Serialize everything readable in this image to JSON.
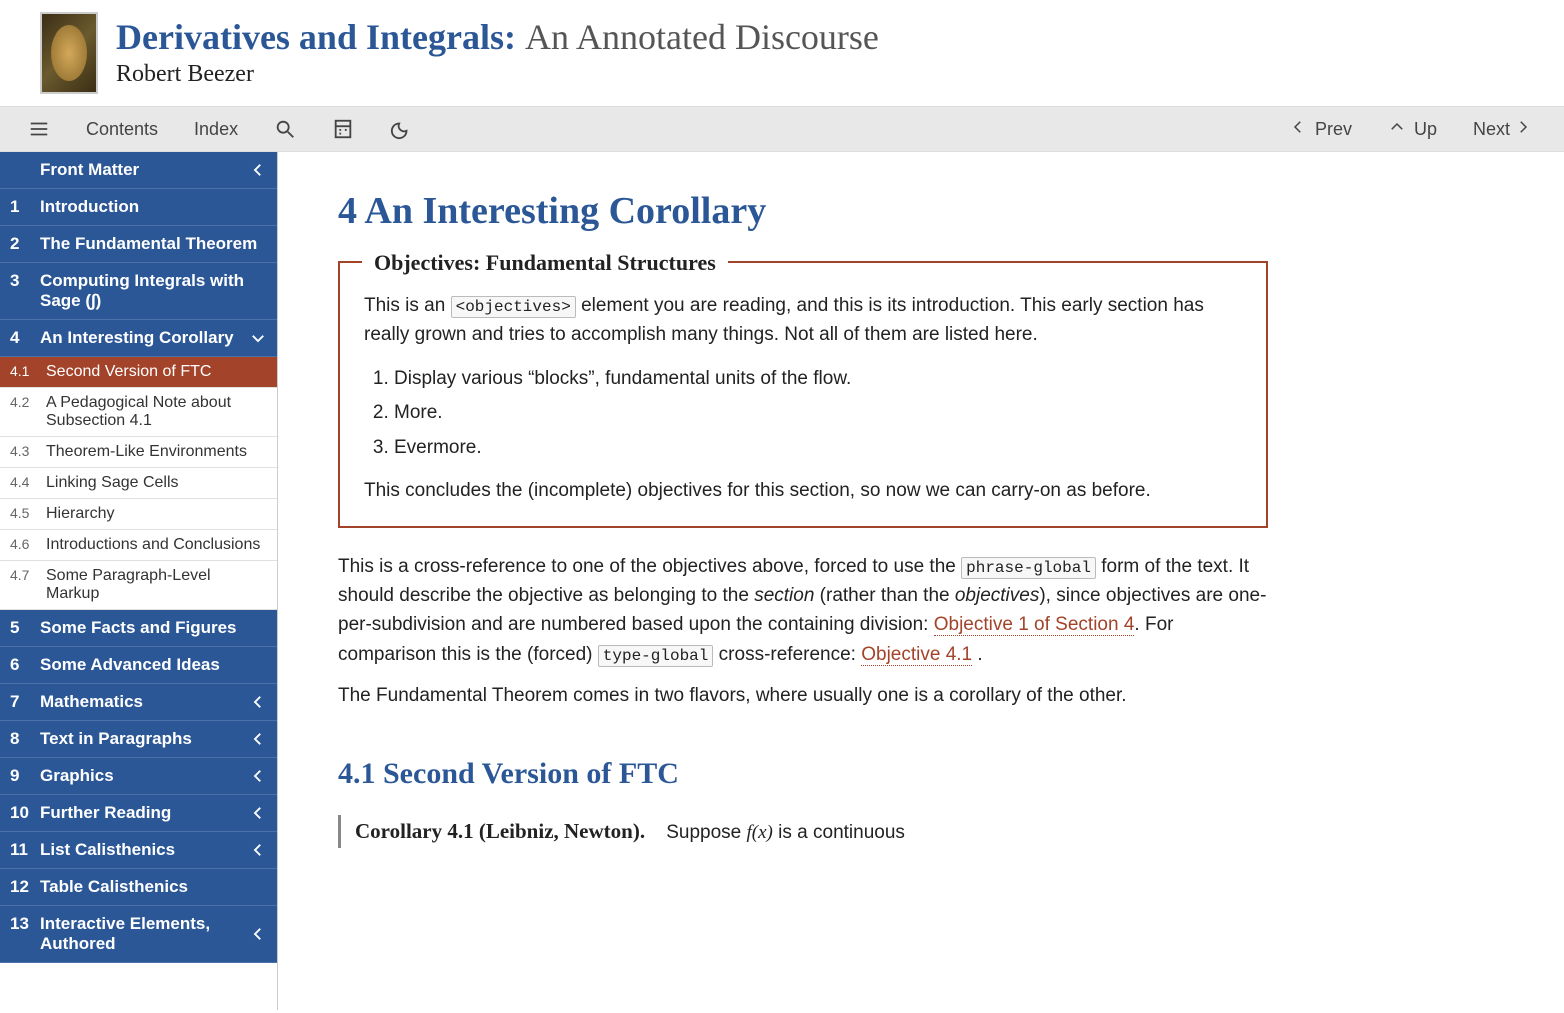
{
  "header": {
    "title_main": "Derivatives and Integrals:",
    "title_sub": "An Annotated Discourse",
    "author": "Robert Beezer"
  },
  "toolbar": {
    "contents": "Contents",
    "index": "Index",
    "prev": "Prev",
    "up": "Up",
    "next": "Next"
  },
  "toc": {
    "front": "Front Matter",
    "items": [
      {
        "num": "1",
        "label": "Introduction"
      },
      {
        "num": "2",
        "label": "The Fundamental Theorem"
      },
      {
        "num": "3",
        "label": "Computing Integrals with Sage (∫)"
      },
      {
        "num": "4",
        "label": "An Interesting Corollary",
        "expanded": true
      },
      {
        "num": "5",
        "label": "Some Facts and Figures"
      },
      {
        "num": "6",
        "label": "Some Advanced Ideas"
      },
      {
        "num": "7",
        "label": "Mathematics",
        "chev": true
      },
      {
        "num": "8",
        "label": "Text in Paragraphs",
        "chev": true
      },
      {
        "num": "9",
        "label": "Graphics",
        "chev": true
      },
      {
        "num": "10",
        "label": "Further Reading",
        "chev": true
      },
      {
        "num": "11",
        "label": "List Calisthenics",
        "chev": true
      },
      {
        "num": "12",
        "label": "Table Calisthenics"
      },
      {
        "num": "13",
        "label": "Interactive Elements, Authored",
        "chev": true
      }
    ],
    "subs": [
      {
        "num": "4.1",
        "label": "Second Version of FTC",
        "active": true
      },
      {
        "num": "4.2",
        "label": "A Pedagogical Note about Subsection 4.1"
      },
      {
        "num": "4.3",
        "label": "Theorem-Like Environments"
      },
      {
        "num": "4.4",
        "label": "Linking Sage Cells"
      },
      {
        "num": "4.5",
        "label": "Hierarchy"
      },
      {
        "num": "4.6",
        "label": "Introductions and Conclusions"
      },
      {
        "num": "4.7",
        "label": "Some Paragraph-Level Markup"
      }
    ]
  },
  "content": {
    "section_title": "4 An Interesting Corollary",
    "objectives": {
      "title": "Objectives: Fundamental Structures",
      "intro_before": "This is an ",
      "intro_code": "<objectives>",
      "intro_after": " element you are reading, and this is its introduction. This early section has really grown and tries to accomplish many things. Not all of them are listed here.",
      "items": [
        "Display various “blocks”, fundamental units of the flow.",
        "More.",
        "Evermore."
      ],
      "outro": "This concludes the (incomplete) objectives for this section, so now we can carry-on as before."
    },
    "para1_a": "This is a cross-reference to one of the objectives above, forced to use the ",
    "para1_code1": "phrase-global",
    "para1_b": " form of the text. It should describe the objective as belonging to the ",
    "para1_em1": "section",
    "para1_c": " (rather than the ",
    "para1_em2": "objectives",
    "para1_d": "), since objectives are one-per-subdivision and are numbered based upon the containing division: ",
    "para1_link1": "Objective 1 of Section 4",
    "para1_e": ". For comparison this is the (forced) ",
    "para1_code2": "type-global",
    "para1_f": " cross-reference: ",
    "para1_link2": "Objective 4.1",
    "para1_g": " .",
    "para2": "The Fundamental Theorem comes in two flavors, where usually one is a corollary of the other.",
    "subsection_title": "4.1 Second Version of FTC",
    "corollary_head": "Corollary 4.1 (Leibniz, Newton).",
    "corollary_a": "Suppose ",
    "corollary_math": "f(x)",
    "corollary_b": " is a continuous"
  }
}
